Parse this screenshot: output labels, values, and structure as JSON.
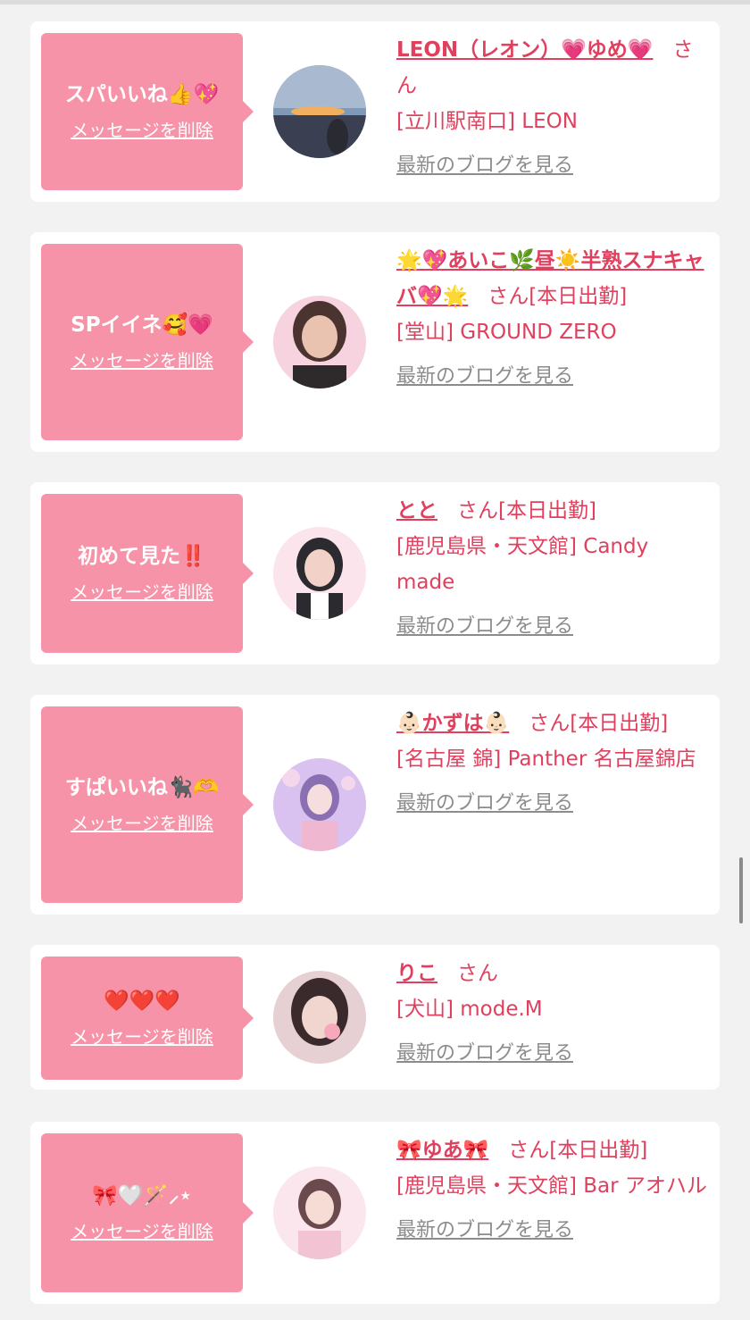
{
  "common": {
    "delete_label": "メッセージを削除",
    "san": "さん",
    "blog_link": "最新のブログを見る"
  },
  "entries": [
    {
      "message": "スパいいね👍💖",
      "name": "LEON（レオン）💗ゆめ💗",
      "status": "",
      "store": "[立川駅南口] LEON",
      "avatar_colors": [
        "#7f9ab8",
        "#f0b060",
        "#3b3f52"
      ]
    },
    {
      "message": "SPイイネ🥰💗",
      "name": "🌟💖あいこ🌿昼☀️半熟スナキャバ💖🌟",
      "status": "[本日出勤]",
      "store": "[堂山] GROUND ZERO",
      "avatar_colors": [
        "#f6d3df",
        "#caa08a",
        "#4b3430"
      ]
    },
    {
      "message": "初めて見た‼️",
      "name": "とと",
      "status": "[本日出勤]",
      "store": "[鹿児島県・天文館] Candy made",
      "avatar_colors": [
        "#fbe4ec",
        "#f2c6c8",
        "#2b2b2f"
      ]
    },
    {
      "message": "すぱいいね🐈‍⬛🫶",
      "name": "👶🏻かずは👶🏻",
      "status": "[本日出勤]",
      "store": "[名古屋 錦] Panther 名古屋錦店",
      "avatar_colors": [
        "#d9c2f0",
        "#f4d7ea",
        "#8a6fb3"
      ]
    },
    {
      "message": "❤️❤️❤️",
      "name": "りこ",
      "status": "",
      "store": "[犬山] mode.M",
      "avatar_colors": [
        "#e7d0d3",
        "#b98b8f",
        "#3a2a2c"
      ]
    },
    {
      "message": "🎀🤍🪄⸝⋆",
      "name": "🎀ゆあ🎀",
      "status": "[本日出勤]",
      "store": "[鹿児島県・天文館] Bar アオハル",
      "avatar_colors": [
        "#fbe6ee",
        "#f2c3d3",
        "#6b4a4e"
      ]
    }
  ]
}
